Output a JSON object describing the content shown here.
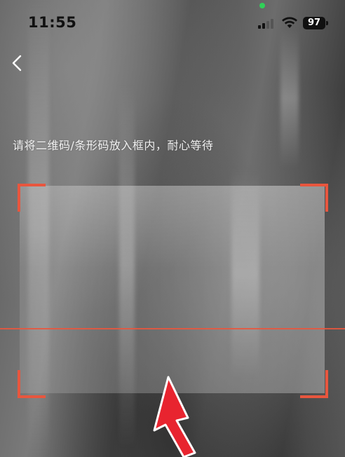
{
  "status_bar": {
    "time": "11:55",
    "battery": "97",
    "icons": [
      "camera-in-use-dot",
      "cellular-signal-icon",
      "wifi-icon",
      "battery-icon"
    ]
  },
  "nav": {
    "back_icon": "chevron-left-icon"
  },
  "scanner": {
    "hint": "请将二维码/条形码放入框内，耐心等待",
    "accent_color": "#e8563e"
  }
}
